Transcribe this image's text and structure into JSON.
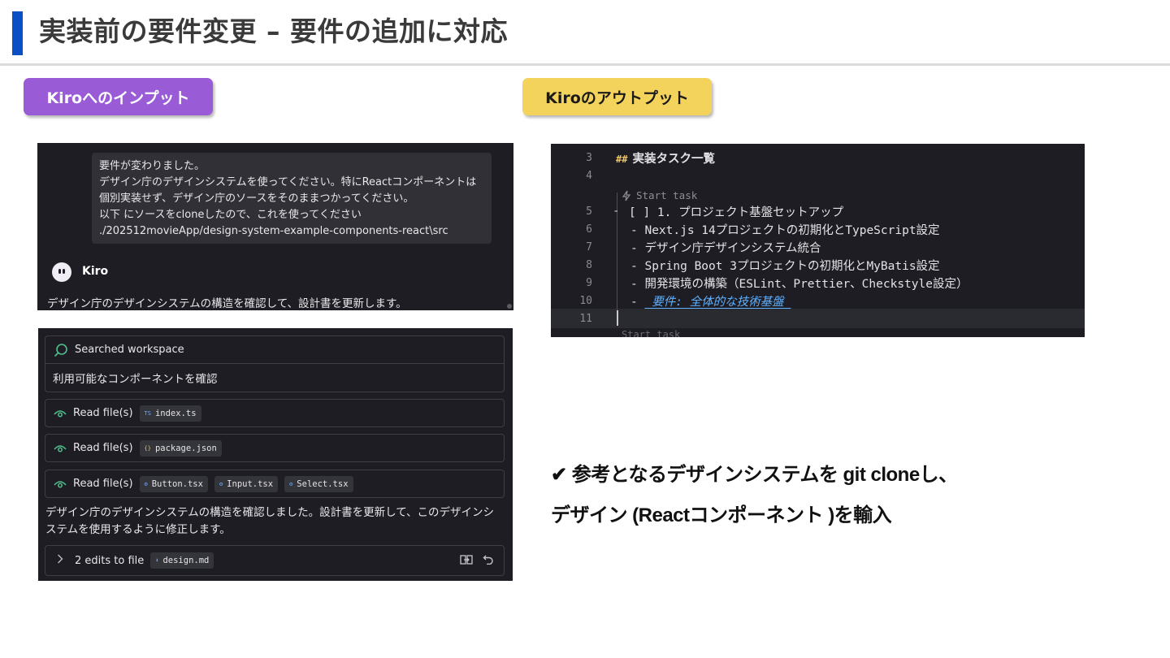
{
  "slide": {
    "title": "実装前の要件変更 – 要件の追加に対応",
    "input_label": "Kiroへのインプット",
    "output_label": "Kiroのアウトプット",
    "colors": {
      "accent": "#0a4fc4",
      "input_pill": "#9a5bd6",
      "output_pill": "#f4d35c",
      "panel_bg": "#1e1d23"
    }
  },
  "chat1": {
    "user_message": [
      "要件が変わりました。",
      "デザイン庁のデザインシステムを使ってください。特にReactコンポーネントは",
      "個別実装せず、デザイン庁のソースをそのままつかってください。",
      "以下 にソースをcloneしたので、これを使ってください",
      "./202512movieApp/design-system-example-components-react\\src"
    ],
    "agent_name": "Kiro",
    "agent_message": "デザイン庁のデザインシステムの構造を確認して、設計書を更新します。"
  },
  "chat2": {
    "search_label": "Searched workspace",
    "search_query": "利用可能なコンポーネントを確認",
    "read_label": "Read file(s)",
    "read_rows": [
      {
        "files": [
          {
            "icon": "TS",
            "name": "index.ts"
          }
        ]
      },
      {
        "files": [
          {
            "icon": "{}",
            "name": "package.json"
          }
        ]
      },
      {
        "files": [
          {
            "icon": "⚙",
            "name": "Button.tsx"
          },
          {
            "icon": "⚙",
            "name": "Input.tsx"
          },
          {
            "icon": "⚙",
            "name": "Select.tsx"
          }
        ]
      }
    ],
    "message_line1": "デザイン庁のデザインシステムの構造を確認しました。設計書を更新して、このデザインシ",
    "message_line2": "ステムを使用するように修正します。",
    "edits_label": "2 edits to file",
    "edits_file_icon": "⬇",
    "edits_file": "design.md"
  },
  "code": {
    "codelens": "Start task",
    "codelens_next": "Start task",
    "lines": [
      {
        "num": "3",
        "text": "実装タスク一覧",
        "prefix": "##"
      },
      {
        "num": "4",
        "text": ""
      },
      {
        "num": "5",
        "text": "[ ] 1. プロジェクト基盤セットアップ"
      },
      {
        "num": "6",
        "text": "- Next.js 14プロジェクトの初期化とTypeScript設定"
      },
      {
        "num": "7",
        "text": "- デザイン庁デザインシステム統合"
      },
      {
        "num": "8",
        "text": "- Spring Boot 3プロジェクトの初期化とMyBatis設定"
      },
      {
        "num": "9",
        "text": "- 開発環境の構築（ESLint、Prettier、Checkstyle設定）"
      },
      {
        "num": "10",
        "text": "- ",
        "emph": "_要件: 全体的な技術基盤_"
      },
      {
        "num": "11",
        "text": ""
      }
    ]
  },
  "note": {
    "line1": "✔ 参考となるデザインシステムを git cloneし、",
    "line2": "デザイン (Reactコンポーネント )を輸入"
  }
}
